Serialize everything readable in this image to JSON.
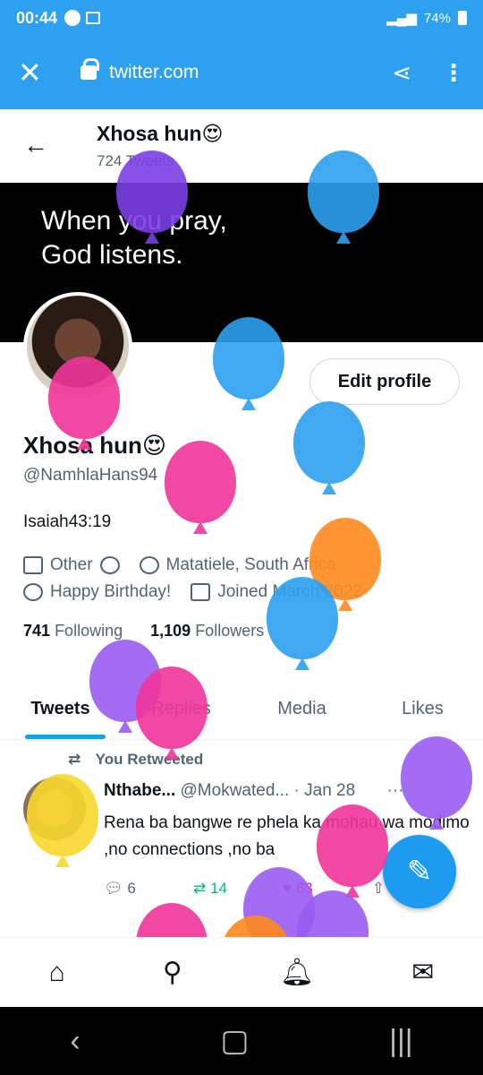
{
  "status_bar": {
    "time": "00:44",
    "battery": "74%"
  },
  "browser": {
    "url": "twitter.com"
  },
  "nav": {
    "name": "Xhosa hun😍",
    "tweet_count": "724 Tweets"
  },
  "banner_text": "When you pray,\nGod listens.",
  "edit_button": "Edit profile",
  "profile": {
    "name": "Xhosa hun😍",
    "handle": "@NamhlaHans94",
    "bio": "Isaiah43:19",
    "category": "Other",
    "location": "Matatiele, South Africa",
    "birthday": "Happy Birthday!",
    "joined": "Joined March 2022",
    "following_count": "741",
    "following_label": "Following",
    "followers_count": "1,109",
    "followers_label": "Followers"
  },
  "tabs": [
    "Tweets",
    "Replies",
    "Media",
    "Likes"
  ],
  "tweet": {
    "retweet_label": "You Retweeted",
    "author": "Nthabe...",
    "handle": "@Mokwated...",
    "date": "· Jan 28",
    "more": "···",
    "text": "Rena ba bangwe re phela ka mohau wa modimo ,no connections ,no ba",
    "replies": "6",
    "retweets": "14",
    "likes": "63"
  },
  "colors": {
    "accent": "#1d9bf0",
    "browser_bar": "#2da0f0"
  }
}
